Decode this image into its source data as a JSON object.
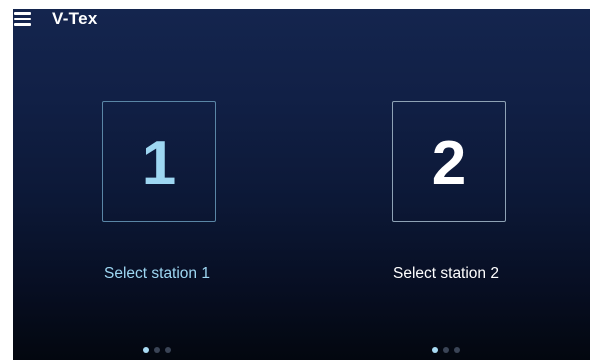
{
  "header": {
    "title": "V-Tex",
    "menu_icon": "hamburger-menu-icon"
  },
  "stations": [
    {
      "number": "1",
      "label": "Select station 1",
      "selected": true,
      "page_indicator": {
        "pages": 3,
        "active": 1
      }
    },
    {
      "number": "2",
      "label": "Select station 2",
      "selected": false,
      "page_indicator": {
        "pages": 3,
        "active": 1
      }
    }
  ],
  "colors": {
    "background_top": "#14254e",
    "background_bottom": "#03070f",
    "selected_accent": "#9ed7f2",
    "text": "#ffffff"
  }
}
